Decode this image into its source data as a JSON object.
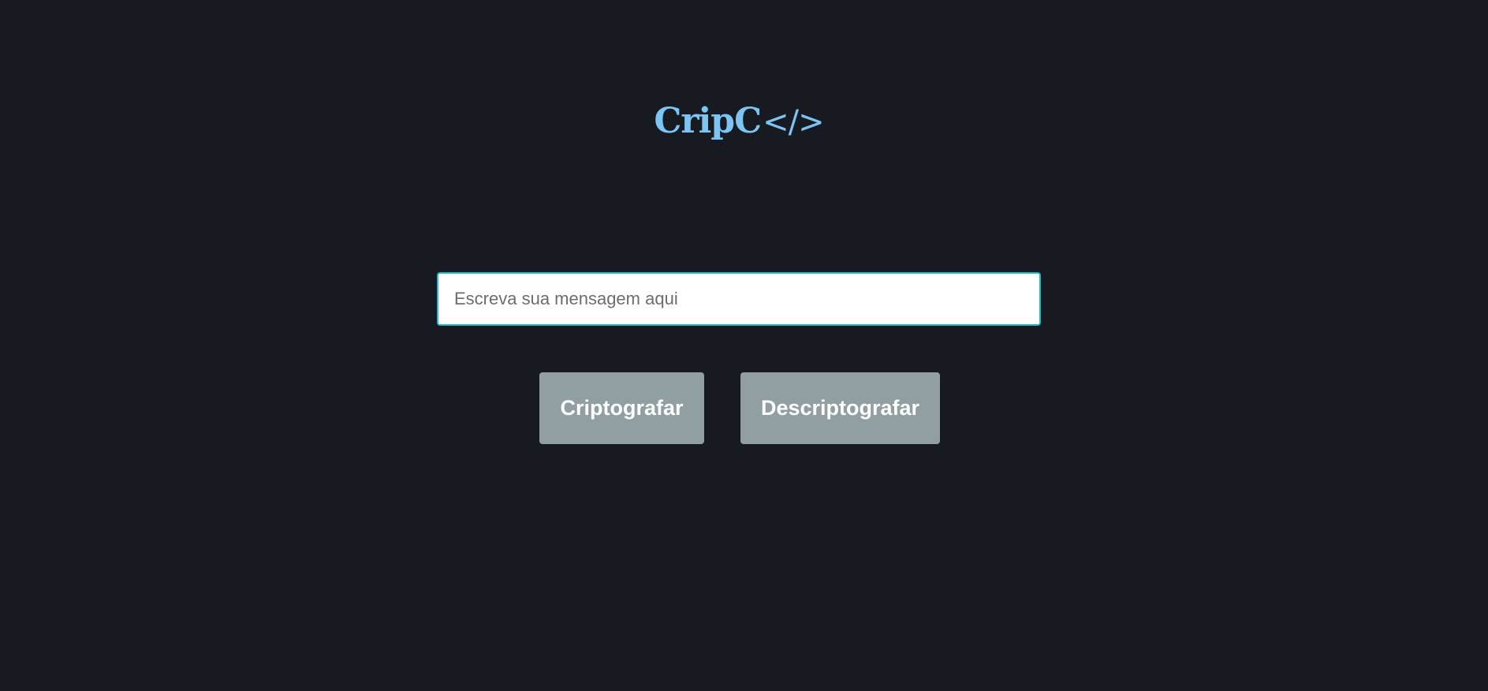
{
  "logo": {
    "name": "CripC",
    "code_symbol": "</>"
  },
  "input": {
    "placeholder": "Escreva sua mensagem aqui",
    "value": ""
  },
  "buttons": {
    "encrypt_label": "Criptografar",
    "decrypt_label": "Descriptografar"
  },
  "colors": {
    "background": "#171a21",
    "logo": "#7cc4f2",
    "input_border": "#1fb8c8",
    "button_bg": "#919fa2",
    "button_text": "#ffffff"
  }
}
